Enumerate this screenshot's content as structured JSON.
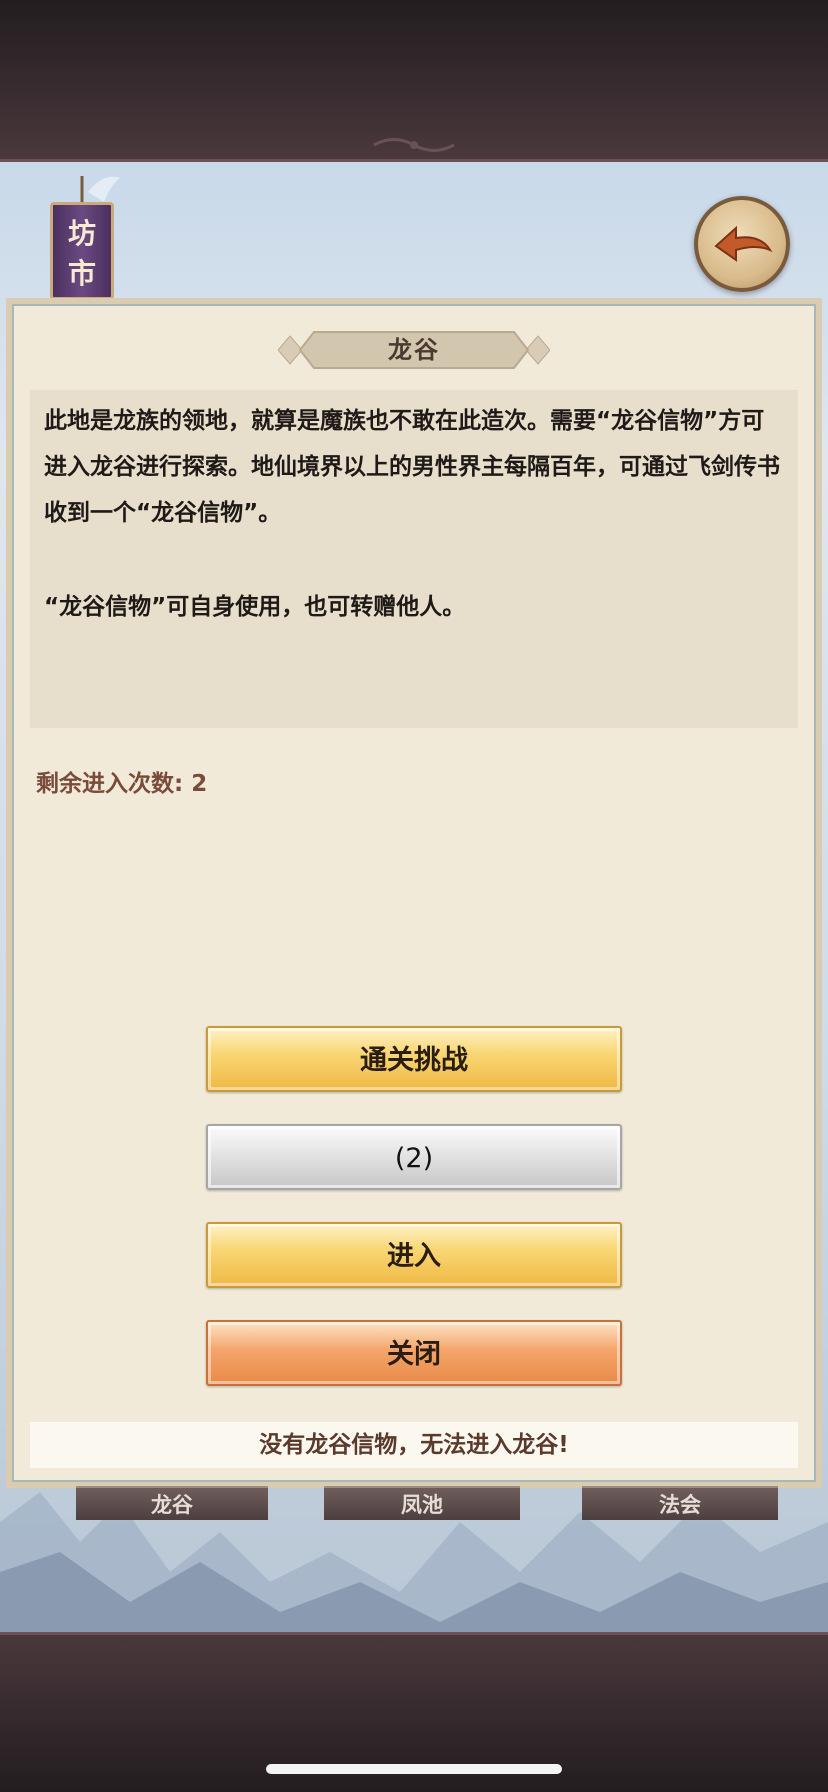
{
  "sign": {
    "char1": "坊",
    "char2": "市"
  },
  "dialog": {
    "title": "龙谷",
    "paragraph1": "此地是龙族的领地，就算是魔族也不敢在此造次。需要“龙谷信物”方可进入龙谷进行探索。地仙境界以上的男性界主每隔百年，可通过飞剑传书收到一个“龙谷信物”。",
    "paragraph2": "“龙谷信物”可自身使用，也可转赠他人。",
    "remaining_label": "剩余进入次数:",
    "remaining_count": "2"
  },
  "buttons": {
    "challenge": "通关挑战",
    "sweep": "(2)",
    "enter": "进入",
    "close": "关闭"
  },
  "notice": "没有龙谷信物，无法进入龙谷!",
  "tabs": [
    "龙谷",
    "凤池",
    "法会"
  ],
  "colors": {
    "gold_button": "#f9d775",
    "silver_button": "#e4e4e4",
    "orange_button": "#f4a56b",
    "panel_bg": "#f1ead8"
  },
  "icons": {
    "back": "back-arrow-icon"
  }
}
